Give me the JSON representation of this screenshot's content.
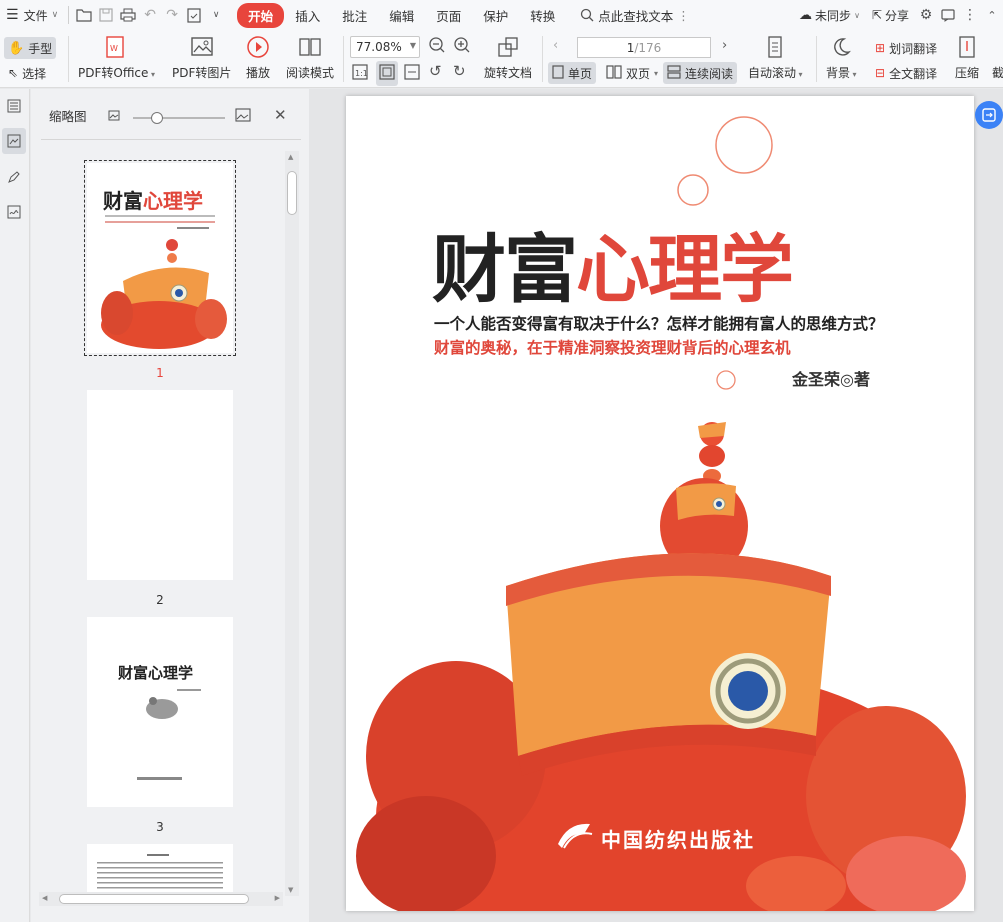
{
  "menu": {
    "file_label": "文件",
    "tabs": [
      "开始",
      "插入",
      "批注",
      "编辑",
      "页面",
      "保护",
      "转换"
    ],
    "active_tab": "开始",
    "search_label": "点此查找文本",
    "sync_label": "未同步",
    "share_label": "分享"
  },
  "ribbon": {
    "hand_label": "手型",
    "select_label": "选择",
    "pdf_to_office": "PDF转Office",
    "pdf_to_image": "PDF转图片",
    "play": "播放",
    "read_mode": "阅读模式",
    "zoom": "77.08%",
    "rotate_doc": "旋转文档",
    "page_current": "1",
    "page_total": "/176",
    "single_page": "单页",
    "double_page": "双页",
    "continuous": "连续阅读",
    "auto_scroll": "自动滚动",
    "background": "背景",
    "word_translate": "划词翻译",
    "full_translate": "全文翻译",
    "compress": "压缩",
    "cut_label": "截"
  },
  "thumbs": {
    "title": "缩略图",
    "pages": [
      {
        "num": "1",
        "title_black": "财富",
        "title_red": "心理学"
      },
      {
        "num": "2"
      },
      {
        "num": "3",
        "title": "财富心理学"
      }
    ]
  },
  "cover": {
    "title_black": "财富",
    "title_red": "心理学",
    "subtitle_1": "一个人能否变得富有取决于什么？怎样才能拥有富人的思维方式？",
    "subtitle_2": "财富的奥秘，在于精准洞察投资理财背后的心理玄机",
    "author": "金圣荣◎著",
    "publisher": "中国纺织出版社"
  },
  "colors": {
    "accent_red": "#e8453c",
    "cover_red": "#e0473b",
    "fish_orange": "#f08a3c",
    "toolbar_bg": "#f7f8fa"
  }
}
